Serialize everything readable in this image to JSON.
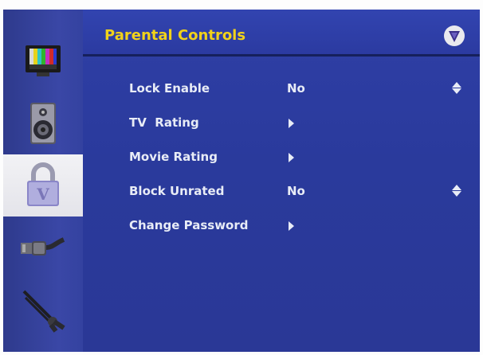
{
  "sidebar": {
    "items": [
      {
        "icon": "tv-color-bars-icon",
        "selected": false
      },
      {
        "icon": "speaker-icon",
        "selected": false
      },
      {
        "icon": "padlock-icon",
        "selected": true
      },
      {
        "icon": "cable-connector-icon",
        "selected": false
      },
      {
        "icon": "pliers-tool-icon",
        "selected": false
      }
    ]
  },
  "header": {
    "title": "Parental Controls",
    "logo_icon": "vizio-v-logo-icon"
  },
  "menu": {
    "items": [
      {
        "label": "Lock Enable",
        "value": "No",
        "control": "up-down-arrows-icon"
      },
      {
        "label": "TV  Rating",
        "control": "submenu-arrow-icon"
      },
      {
        "label": "Movie Rating",
        "control": "submenu-arrow-icon"
      },
      {
        "label": "Block Unrated",
        "value": "No",
        "control": "up-down-arrows-icon"
      },
      {
        "label": "Change Password",
        "control": "submenu-arrow-icon"
      }
    ]
  },
  "colors": {
    "panel_blue": "#2a3a9c",
    "title_yellow": "#f1d21a",
    "text_white": "#e8ecf6",
    "selected_tab": "#e4e4ea"
  }
}
